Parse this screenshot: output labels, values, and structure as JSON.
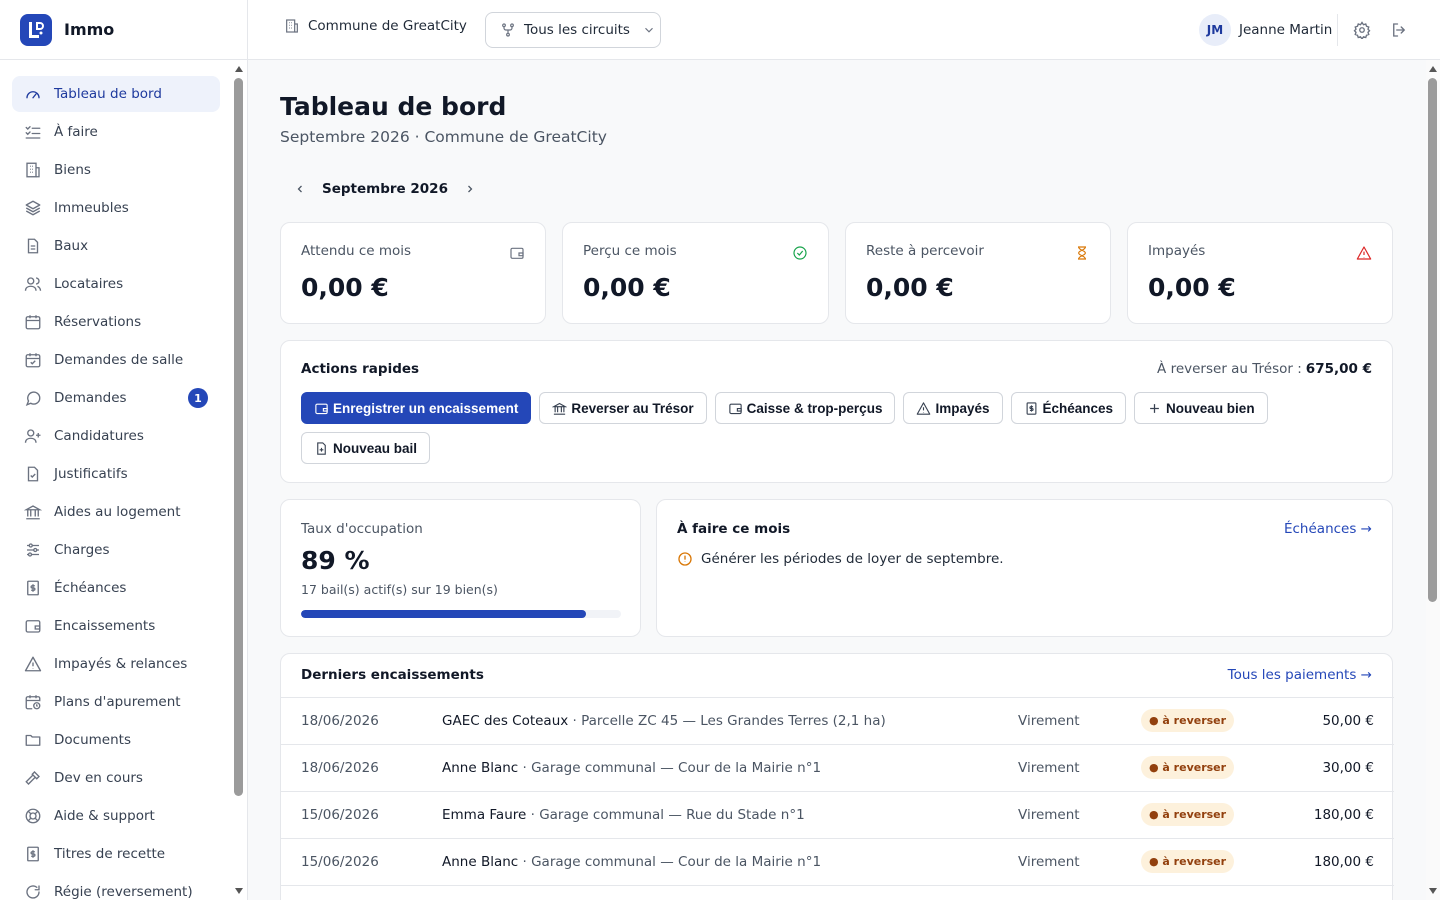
{
  "brand": {
    "name": "Immo"
  },
  "sidebar": {
    "items": [
      {
        "label": "Tableau de bord",
        "icon": "gauge-icon",
        "active": true
      },
      {
        "label": "À faire",
        "icon": "checklist-icon"
      },
      {
        "label": "Biens",
        "icon": "building-icon"
      },
      {
        "label": "Immeubles",
        "icon": "layers-icon"
      },
      {
        "label": "Baux",
        "icon": "file-icon"
      },
      {
        "label": "Locataires",
        "icon": "users-icon"
      },
      {
        "label": "Réservations",
        "icon": "calendar-icon"
      },
      {
        "label": "Demandes de salle",
        "icon": "calendar-check-icon"
      },
      {
        "label": "Demandes",
        "icon": "chat-bubble-icon",
        "badge": "1"
      },
      {
        "label": "Candidatures",
        "icon": "user-plus-icon"
      },
      {
        "label": "Justificatifs",
        "icon": "file-check-icon"
      },
      {
        "label": "Aides au logement",
        "icon": "landmark-icon"
      },
      {
        "label": "Charges",
        "icon": "sliders-icon"
      },
      {
        "label": "Échéances",
        "icon": "receipt-icon"
      },
      {
        "label": "Encaissements",
        "icon": "wallet-icon"
      },
      {
        "label": "Impayés & relances",
        "icon": "warning-icon"
      },
      {
        "label": "Plans d'apurement",
        "icon": "calendar-clock-icon"
      },
      {
        "label": "Documents",
        "icon": "folder-icon"
      },
      {
        "label": "Dev en cours",
        "icon": "hammer-icon"
      },
      {
        "label": "Aide & support",
        "icon": "lifebuoy-icon"
      },
      {
        "label": "Titres de recette",
        "icon": "receipt-icon"
      },
      {
        "label": "Régie (reversement)",
        "icon": "refresh-icon"
      }
    ]
  },
  "topbar": {
    "commune": "Commune de GreatCity",
    "circuits": "Tous les circuits",
    "user": {
      "initials": "JM",
      "name": "Jeanne Martin"
    }
  },
  "header": {
    "title": "Tableau de bord",
    "subtitle": "Septembre 2026 · Commune de GreatCity",
    "month": "Septembre 2026"
  },
  "kpis": [
    {
      "label": "Attendu ce mois",
      "value": "0,00 €",
      "icon": "wallet-icon",
      "color": "#6b7280"
    },
    {
      "label": "Perçu ce mois",
      "value": "0,00 €",
      "icon": "check-circle-icon",
      "color": "#16a34a"
    },
    {
      "label": "Reste à percevoir",
      "value": "0,00 €",
      "icon": "hourglass-icon",
      "color": "#d97706"
    },
    {
      "label": "Impayés",
      "value": "0,00 €",
      "icon": "warning-icon",
      "color": "#dc2626"
    }
  ],
  "quick_actions": {
    "title": "Actions rapides",
    "reverse_label": "À reverser au Trésor :",
    "reverse_amount": "675,00 €",
    "buttons": [
      {
        "label": "Enregistrer un encaissement",
        "icon": "wallet-icon",
        "primary": true
      },
      {
        "label": "Reverser au Trésor",
        "icon": "landmark-icon"
      },
      {
        "label": "Caisse & trop-perçus",
        "icon": "wallet-icon"
      },
      {
        "label": "Impayés",
        "icon": "warning-icon"
      },
      {
        "label": "Échéances",
        "icon": "receipt-icon"
      },
      {
        "label": "Nouveau bien",
        "icon": "plus-icon"
      },
      {
        "label": "Nouveau bail",
        "icon": "file-plus-icon"
      }
    ]
  },
  "occupancy": {
    "label": "Taux d'occupation",
    "value": "89 %",
    "percent": 89,
    "detail": "17 bail(s) actif(s) sur 19 bien(s)"
  },
  "todo": {
    "title": "À faire ce mois",
    "link": "Échéances →",
    "items": [
      {
        "text": "Générer les périodes de loyer de septembre."
      }
    ]
  },
  "payments": {
    "title": "Derniers encaissements",
    "link": "Tous les paiements →",
    "rows": [
      {
        "date": "18/06/2026",
        "name": "GAEC des Coteaux",
        "detail": "Parcelle ZC 45 — Les Grandes Terres (2,1 ha)",
        "mode": "Virement",
        "status": "● à reverser",
        "amount": "50,00 €"
      },
      {
        "date": "18/06/2026",
        "name": "Anne Blanc",
        "detail": "Garage communal — Cour de la Mairie n°1",
        "mode": "Virement",
        "status": "● à reverser",
        "amount": "30,00 €"
      },
      {
        "date": "15/06/2026",
        "name": "Emma Faure",
        "detail": "Garage communal — Rue du Stade n°1",
        "mode": "Virement",
        "status": "● à reverser",
        "amount": "180,00 €"
      },
      {
        "date": "15/06/2026",
        "name": "Anne Blanc",
        "detail": "Garage communal — Cour de la Mairie n°1",
        "mode": "Virement",
        "status": "● à reverser",
        "amount": "180,00 €"
      }
    ]
  },
  "colors": {
    "accent": "#2447b8",
    "accent_bg": "#eef2fb",
    "warning_badge_bg": "#fdf1dc",
    "warning_badge_text": "#92400e"
  }
}
